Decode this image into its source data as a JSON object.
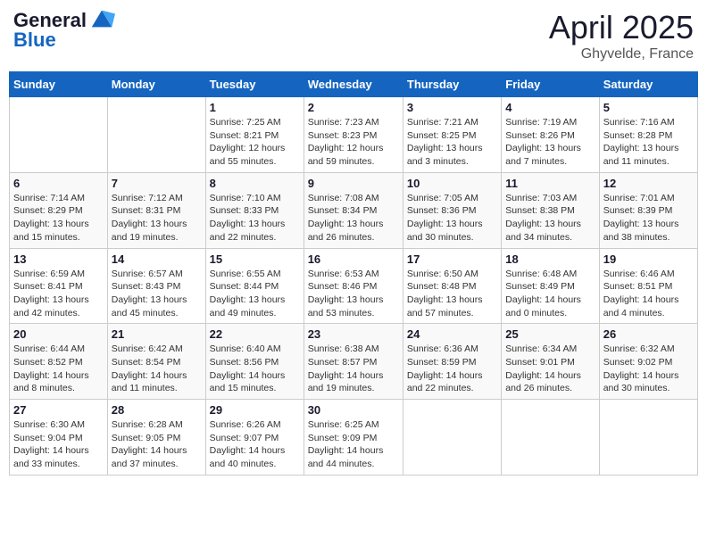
{
  "header": {
    "logo_line1": "General",
    "logo_line2": "Blue",
    "month": "April 2025",
    "location": "Ghyvelde, France"
  },
  "days_of_week": [
    "Sunday",
    "Monday",
    "Tuesday",
    "Wednesday",
    "Thursday",
    "Friday",
    "Saturday"
  ],
  "weeks": [
    [
      {
        "day": "",
        "sunrise": "",
        "sunset": "",
        "daylight": ""
      },
      {
        "day": "",
        "sunrise": "",
        "sunset": "",
        "daylight": ""
      },
      {
        "day": "1",
        "sunrise": "Sunrise: 7:25 AM",
        "sunset": "Sunset: 8:21 PM",
        "daylight": "Daylight: 12 hours and 55 minutes."
      },
      {
        "day": "2",
        "sunrise": "Sunrise: 7:23 AM",
        "sunset": "Sunset: 8:23 PM",
        "daylight": "Daylight: 12 hours and 59 minutes."
      },
      {
        "day": "3",
        "sunrise": "Sunrise: 7:21 AM",
        "sunset": "Sunset: 8:25 PM",
        "daylight": "Daylight: 13 hours and 3 minutes."
      },
      {
        "day": "4",
        "sunrise": "Sunrise: 7:19 AM",
        "sunset": "Sunset: 8:26 PM",
        "daylight": "Daylight: 13 hours and 7 minutes."
      },
      {
        "day": "5",
        "sunrise": "Sunrise: 7:16 AM",
        "sunset": "Sunset: 8:28 PM",
        "daylight": "Daylight: 13 hours and 11 minutes."
      }
    ],
    [
      {
        "day": "6",
        "sunrise": "Sunrise: 7:14 AM",
        "sunset": "Sunset: 8:29 PM",
        "daylight": "Daylight: 13 hours and 15 minutes."
      },
      {
        "day": "7",
        "sunrise": "Sunrise: 7:12 AM",
        "sunset": "Sunset: 8:31 PM",
        "daylight": "Daylight: 13 hours and 19 minutes."
      },
      {
        "day": "8",
        "sunrise": "Sunrise: 7:10 AM",
        "sunset": "Sunset: 8:33 PM",
        "daylight": "Daylight: 13 hours and 22 minutes."
      },
      {
        "day": "9",
        "sunrise": "Sunrise: 7:08 AM",
        "sunset": "Sunset: 8:34 PM",
        "daylight": "Daylight: 13 hours and 26 minutes."
      },
      {
        "day": "10",
        "sunrise": "Sunrise: 7:05 AM",
        "sunset": "Sunset: 8:36 PM",
        "daylight": "Daylight: 13 hours and 30 minutes."
      },
      {
        "day": "11",
        "sunrise": "Sunrise: 7:03 AM",
        "sunset": "Sunset: 8:38 PM",
        "daylight": "Daylight: 13 hours and 34 minutes."
      },
      {
        "day": "12",
        "sunrise": "Sunrise: 7:01 AM",
        "sunset": "Sunset: 8:39 PM",
        "daylight": "Daylight: 13 hours and 38 minutes."
      }
    ],
    [
      {
        "day": "13",
        "sunrise": "Sunrise: 6:59 AM",
        "sunset": "Sunset: 8:41 PM",
        "daylight": "Daylight: 13 hours and 42 minutes."
      },
      {
        "day": "14",
        "sunrise": "Sunrise: 6:57 AM",
        "sunset": "Sunset: 8:43 PM",
        "daylight": "Daylight: 13 hours and 45 minutes."
      },
      {
        "day": "15",
        "sunrise": "Sunrise: 6:55 AM",
        "sunset": "Sunset: 8:44 PM",
        "daylight": "Daylight: 13 hours and 49 minutes."
      },
      {
        "day": "16",
        "sunrise": "Sunrise: 6:53 AM",
        "sunset": "Sunset: 8:46 PM",
        "daylight": "Daylight: 13 hours and 53 minutes."
      },
      {
        "day": "17",
        "sunrise": "Sunrise: 6:50 AM",
        "sunset": "Sunset: 8:48 PM",
        "daylight": "Daylight: 13 hours and 57 minutes."
      },
      {
        "day": "18",
        "sunrise": "Sunrise: 6:48 AM",
        "sunset": "Sunset: 8:49 PM",
        "daylight": "Daylight: 14 hours and 0 minutes."
      },
      {
        "day": "19",
        "sunrise": "Sunrise: 6:46 AM",
        "sunset": "Sunset: 8:51 PM",
        "daylight": "Daylight: 14 hours and 4 minutes."
      }
    ],
    [
      {
        "day": "20",
        "sunrise": "Sunrise: 6:44 AM",
        "sunset": "Sunset: 8:52 PM",
        "daylight": "Daylight: 14 hours and 8 minutes."
      },
      {
        "day": "21",
        "sunrise": "Sunrise: 6:42 AM",
        "sunset": "Sunset: 8:54 PM",
        "daylight": "Daylight: 14 hours and 11 minutes."
      },
      {
        "day": "22",
        "sunrise": "Sunrise: 6:40 AM",
        "sunset": "Sunset: 8:56 PM",
        "daylight": "Daylight: 14 hours and 15 minutes."
      },
      {
        "day": "23",
        "sunrise": "Sunrise: 6:38 AM",
        "sunset": "Sunset: 8:57 PM",
        "daylight": "Daylight: 14 hours and 19 minutes."
      },
      {
        "day": "24",
        "sunrise": "Sunrise: 6:36 AM",
        "sunset": "Sunset: 8:59 PM",
        "daylight": "Daylight: 14 hours and 22 minutes."
      },
      {
        "day": "25",
        "sunrise": "Sunrise: 6:34 AM",
        "sunset": "Sunset: 9:01 PM",
        "daylight": "Daylight: 14 hours and 26 minutes."
      },
      {
        "day": "26",
        "sunrise": "Sunrise: 6:32 AM",
        "sunset": "Sunset: 9:02 PM",
        "daylight": "Daylight: 14 hours and 30 minutes."
      }
    ],
    [
      {
        "day": "27",
        "sunrise": "Sunrise: 6:30 AM",
        "sunset": "Sunset: 9:04 PM",
        "daylight": "Daylight: 14 hours and 33 minutes."
      },
      {
        "day": "28",
        "sunrise": "Sunrise: 6:28 AM",
        "sunset": "Sunset: 9:05 PM",
        "daylight": "Daylight: 14 hours and 37 minutes."
      },
      {
        "day": "29",
        "sunrise": "Sunrise: 6:26 AM",
        "sunset": "Sunset: 9:07 PM",
        "daylight": "Daylight: 14 hours and 40 minutes."
      },
      {
        "day": "30",
        "sunrise": "Sunrise: 6:25 AM",
        "sunset": "Sunset: 9:09 PM",
        "daylight": "Daylight: 14 hours and 44 minutes."
      },
      {
        "day": "",
        "sunrise": "",
        "sunset": "",
        "daylight": ""
      },
      {
        "day": "",
        "sunrise": "",
        "sunset": "",
        "daylight": ""
      },
      {
        "day": "",
        "sunrise": "",
        "sunset": "",
        "daylight": ""
      }
    ]
  ]
}
